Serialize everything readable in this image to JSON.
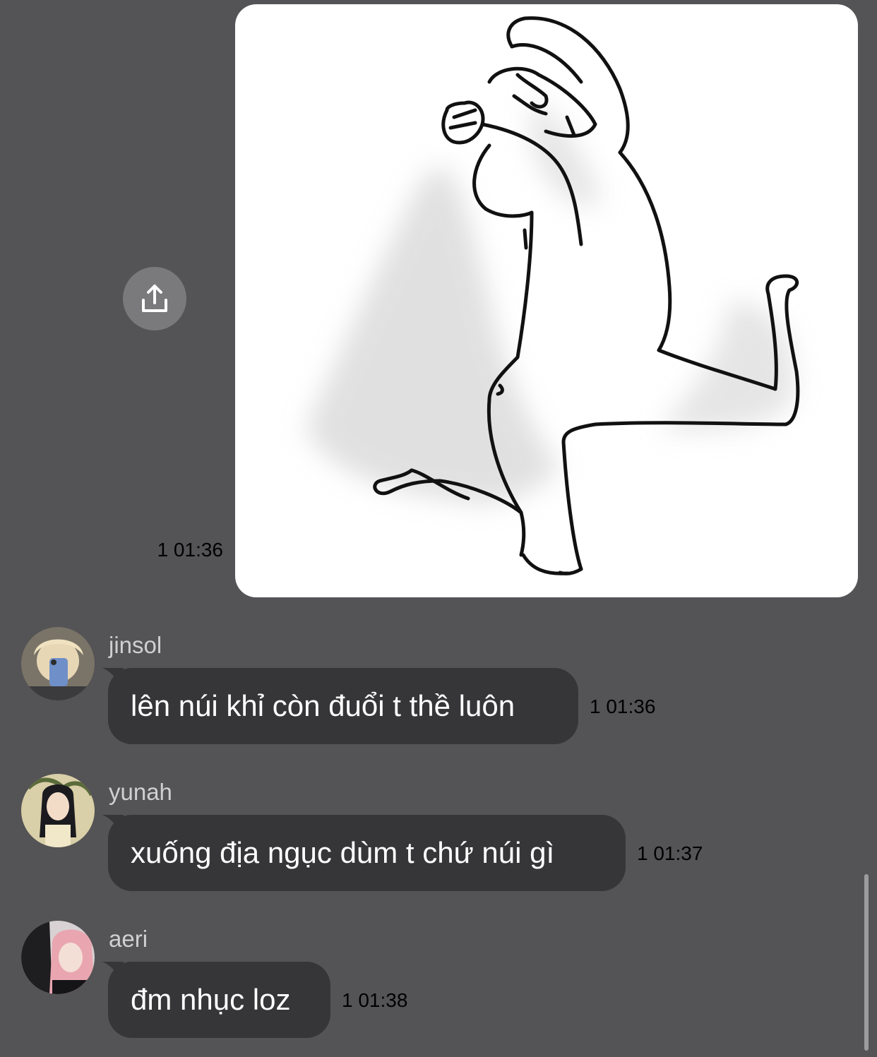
{
  "chat": {
    "image_message": {
      "unread": "1",
      "time": "01:36",
      "share_icon": "share-upload-icon"
    },
    "messages": [
      {
        "sender": "jinsol",
        "text": "lên núi khỉ còn đuổi t thề luôn",
        "unread": "1",
        "time": "01:36"
      },
      {
        "sender": "yunah",
        "text": "xuống địa ngục dùm t chứ núi gì",
        "unread": "1",
        "time": "01:37"
      },
      {
        "sender": "aeri",
        "text": "đm nhục loz",
        "unread": "1",
        "time": "01:38"
      }
    ]
  },
  "colors": {
    "background": "#545355",
    "bubble": "#363537",
    "unread": "#f2e43a",
    "time": "#b4b3b5"
  }
}
